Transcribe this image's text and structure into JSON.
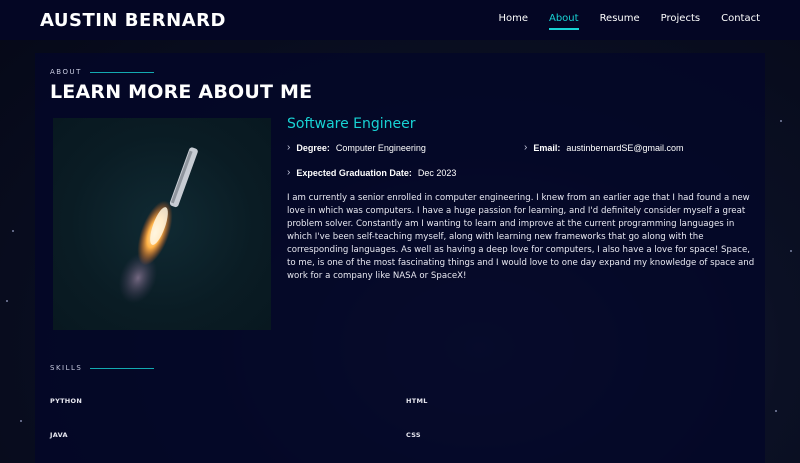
{
  "header": {
    "brand": "AUSTIN BERNARD",
    "nav": [
      "Home",
      "About",
      "Resume",
      "Projects",
      "Contact"
    ],
    "active_nav": "About"
  },
  "about": {
    "section_label": "ABOUT",
    "title": "LEARN MORE ABOUT ME",
    "role": "Software Engineer",
    "degree_label": "Degree:",
    "degree_value": "Computer Engineering",
    "email_label": "Email:",
    "email_value": "austinbernardSE@gmail.com",
    "graduation_label": "Expected Graduation Date:",
    "graduation_value": "Dec 2023",
    "bio": "I am currently a senior enrolled in computer engineering. I knew from an earlier age that I had found a new love in which was computers. I have a huge passion for learning, and I'd definitely consider myself a great problem solver. Constantly am I wanting to learn and improve at the current programming languages in which I've been self-teaching myself, along with learning new frameworks that go along with the corresponding languages. As well as having a deep love for computers, I also have a love for space! Space, to me, is one of the most fascinating things and I would love to one day expand my knowledge of space and work for a company like NASA or SpaceX!"
  },
  "skills": {
    "section_label": "SKILLS",
    "items": [
      "PYTHON",
      "HTML",
      "JAVA",
      "CSS"
    ]
  },
  "colors": {
    "accent": "#18d3d4",
    "header_bg": "#040624",
    "panel_bg": "#040728"
  },
  "icons": {
    "info_bullet": "chevron-right-icon"
  }
}
